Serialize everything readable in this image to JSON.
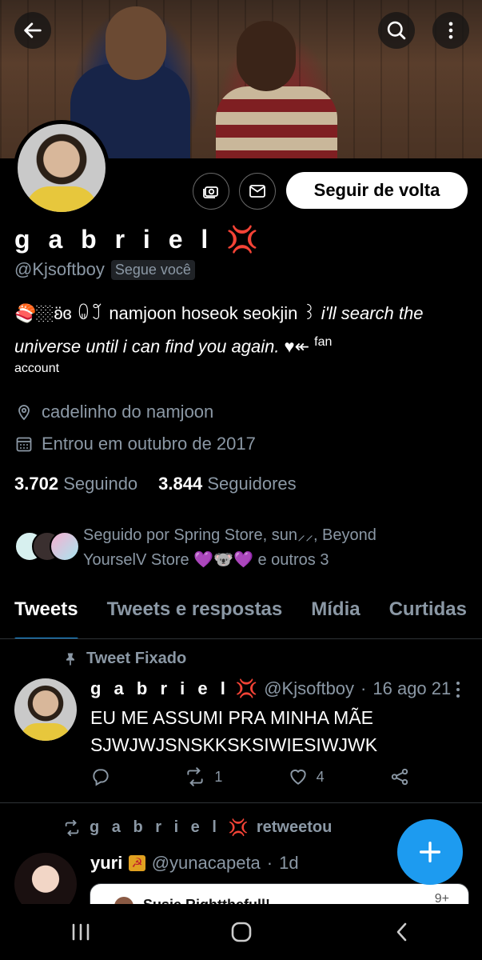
{
  "header": {
    "back_icon": "arrow-left-icon",
    "search_icon": "search-icon",
    "more_icon": "more-vertical-icon"
  },
  "profile": {
    "name": "g a b r i e l",
    "name_emoji": "💢",
    "handle": "@Kjsoftboy",
    "follows_you": "Segue você",
    "follow_back_label": "Seguir de volta",
    "bio_emojis": "🍣🏼ʚ̈ɞ ꐑ꒸",
    "bio_plain": " namjoon hoseok seokjin ꒱ ",
    "bio_italic": "i'll search the universe until i can find you again.",
    "bio_after": " ♥︎↞ ",
    "bio_fan": "fan",
    "bio_account": "account",
    "location": "cadelinho do namjoon",
    "joined": "Entrou em outubro de 2017",
    "following_count": "3.702",
    "following_label": "Seguindo",
    "followers_count": "3.844",
    "followers_label": "Seguidores",
    "followed_by": "Seguido por Spring Store, sun⸝⸝, Beyond YourselV Store 💜🐨💜 e outros 3"
  },
  "tabs": [
    {
      "label": "Tweets",
      "active": true
    },
    {
      "label": "Tweets e respostas"
    },
    {
      "label": "Mídia"
    },
    {
      "label": "Curtidas"
    }
  ],
  "pinned_tweet": {
    "pinned_label": "Tweet Fixado",
    "name": "g a b r i e l",
    "name_emoji": "💢",
    "handle": "@Kjsoftboy",
    "dot": "·",
    "date": "16 ago 21",
    "text": "EU ME ASSUMI PRA MINHA MÃE SJWJWJSNSKKSKSIWIESIWJWK",
    "reply_count": "",
    "retweet_count": "1",
    "like_count": "4"
  },
  "retweet": {
    "name": "g a b r i e l",
    "name_emoji": "💢",
    "suffix": "retweetou",
    "author": "yuri",
    "author_badge": "☭",
    "author_handle": "@yunacapeta",
    "dot": "·",
    "time": "1d",
    "quote_preview": "Susie Rightthefull!",
    "quote_badge": "9+"
  },
  "colors": {
    "accent": "#1d9bf0",
    "muted": "#8b98a5",
    "background": "#000000",
    "divider": "#2f3336"
  }
}
